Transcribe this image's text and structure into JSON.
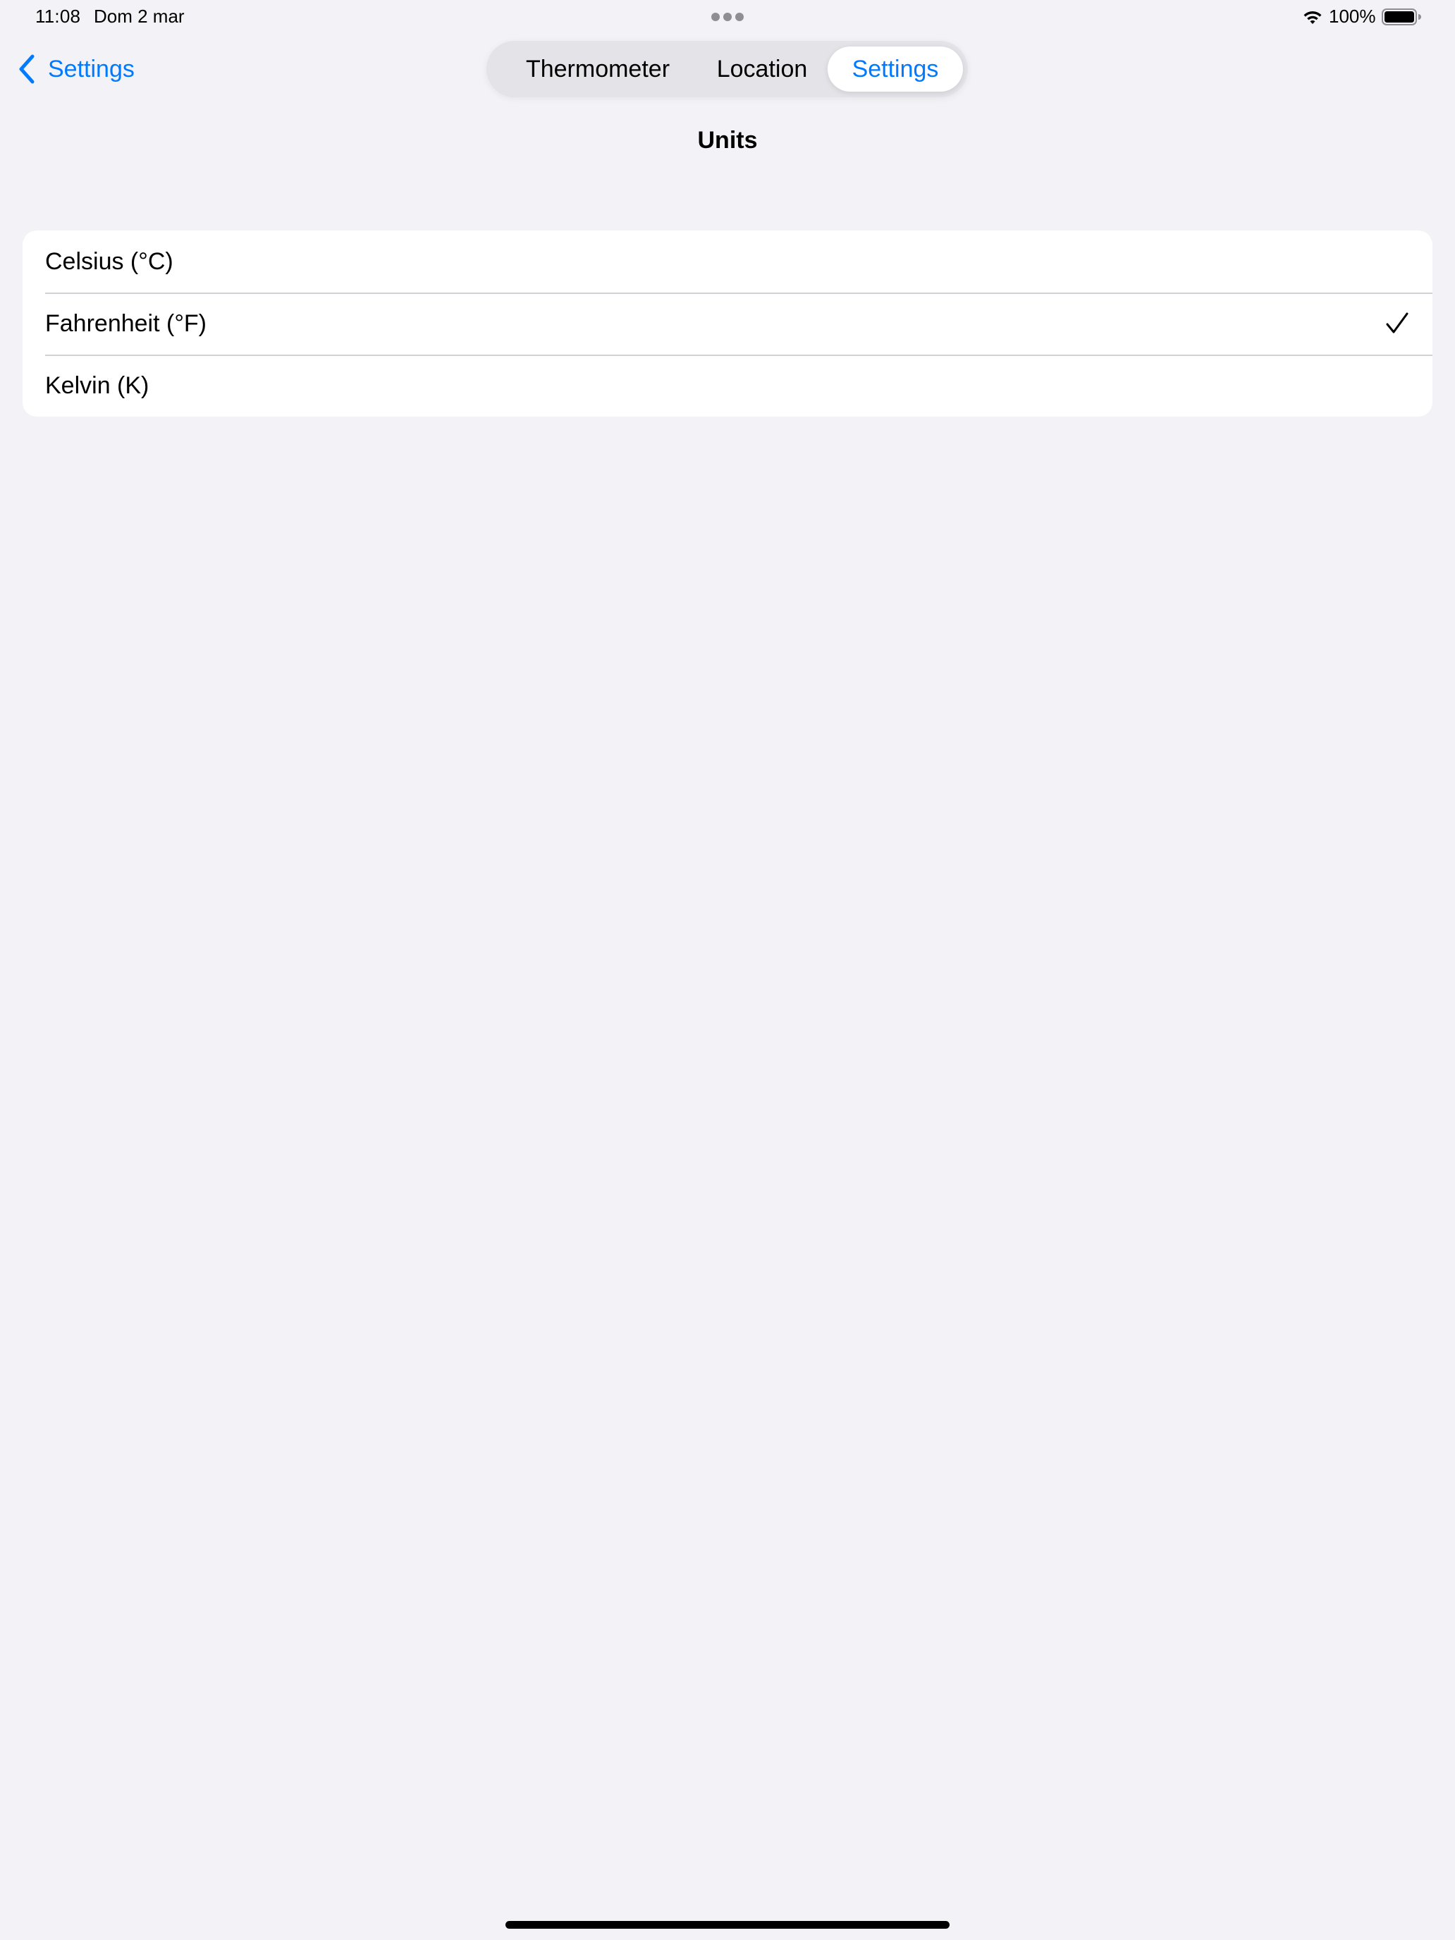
{
  "status_bar": {
    "time": "11:08",
    "date": "Dom 2 mar",
    "battery_percent": "100%",
    "battery_level": 1.0
  },
  "nav": {
    "back_label": "Settings",
    "tabs": [
      {
        "label": "Thermometer",
        "selected": false
      },
      {
        "label": "Location",
        "selected": false
      },
      {
        "label": "Settings",
        "selected": true
      }
    ]
  },
  "page": {
    "title": "Units"
  },
  "units": {
    "options": [
      {
        "label": "Celsius (°C)",
        "checked": false
      },
      {
        "label": "Fahrenheit (°F)",
        "checked": true
      },
      {
        "label": "Kelvin (K)",
        "checked": false
      }
    ]
  },
  "colors": {
    "accent": "#007aff",
    "background": "#f2f2f7",
    "card": "#ffffff",
    "separator": "#d1d1d6"
  },
  "icons": {
    "back": "chevron-left-icon",
    "wifi": "wifi-icon",
    "battery": "battery-icon",
    "selected": "checkmark-icon",
    "multitask": "multitask-dots-icon"
  }
}
